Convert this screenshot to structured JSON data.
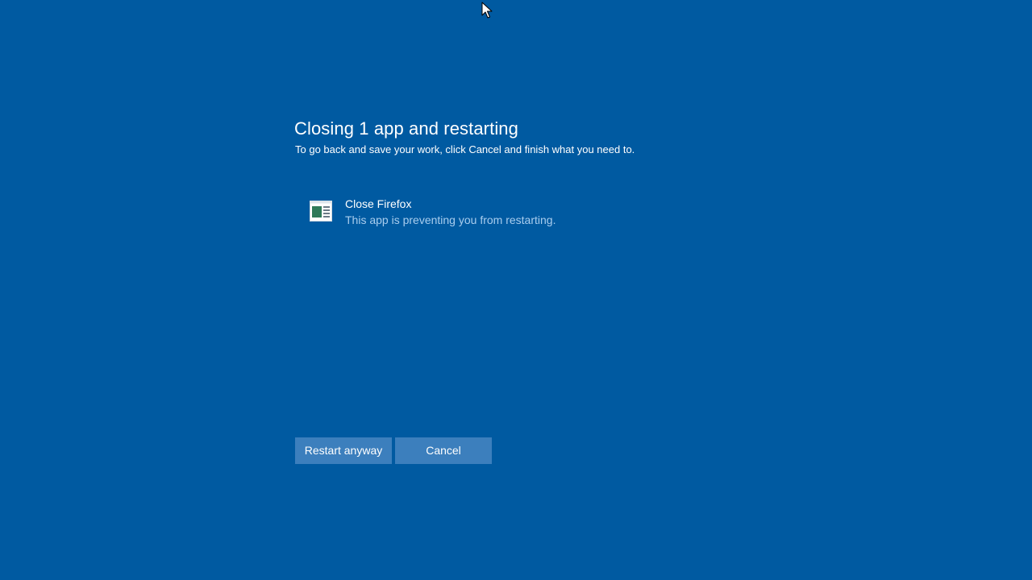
{
  "dialog": {
    "title": "Closing 1 app and restarting",
    "subtitle": "To go back and save your work, click Cancel and finish what you need to."
  },
  "apps": [
    {
      "name": "Close Firefox",
      "status": "This app is preventing you from restarting.",
      "icon": "app-window-icon"
    }
  ],
  "buttons": {
    "restart_label": "Restart anyway",
    "cancel_label": "Cancel"
  },
  "colors": {
    "background": "#005aa1",
    "button": "#3c7fbd",
    "status_text": "#a9cdee",
    "text": "#ffffff"
  },
  "cursor": {
    "icon": "mouse-pointer-icon"
  }
}
